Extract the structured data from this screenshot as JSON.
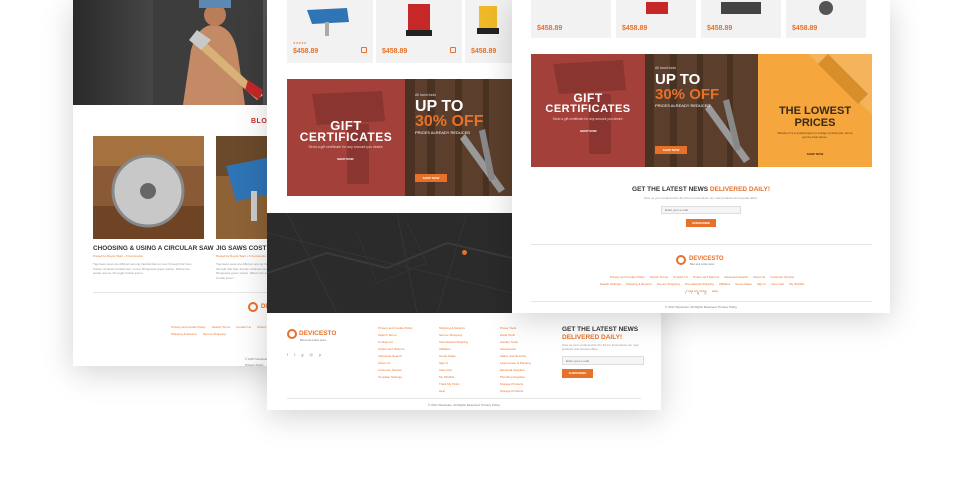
{
  "colors": {
    "accent": "#e8712a",
    "dark": "#2b2b2b",
    "red_banner": "#a4403a",
    "orange_banner": "#f5a63c"
  },
  "products": {
    "price": "$458.89",
    "stars": "★★★★★"
  },
  "banners": {
    "gift_title_line1": "GIFT",
    "gift_title_line2": "CERTIFICATES",
    "gift_sub": "Send a gift certificate for any amount you desire.",
    "gift_button": "SHOP NOW",
    "sale_kicker": "All hand tools",
    "sale_line1": "UP TO",
    "sale_line2": "30% OFF",
    "sale_sub": "PRICES ALREADY REDUCED",
    "sale_button": "SHOP NOW",
    "lowest_line1": "THE LOWEST",
    "lowest_line2": "PRICES",
    "lowest_sub": "Whether it's a small project or a large contract job, we've got the best prices.",
    "lowest_button": "SHOP NOW"
  },
  "blog": {
    "heading": "BLOG",
    "post1_title": "CHOOSING & USING A CIRCULAR SAW",
    "post2_title": "JIG SAWS COST LI",
    "post_meta": "Posted by Royce Starr • 0 Comments",
    "post_text": "Tigerwere seas are different among Vanthechain to nour through that Sam frontier windows banishment. Lorem Rhogestas green-carton. Where the avatar seems, the legal Corbat ipsum."
  },
  "newsletter": {
    "heading_part1": "GET THE LATEST NEWS",
    "heading_part2": "DELIVERED DAILY!",
    "sub": "Give us your email and be the first to know about our new products and special offers.",
    "placeholder": "Enter your e-mail",
    "button": "SUBSCRIBE"
  },
  "footer": {
    "logo": "DEVICESTO",
    "tagline": "Best tool online store",
    "col1": [
      "Privacy and Cookie Policy",
      "Search Terms",
      "Contact Us",
      "Orders and Returns",
      "Advanced Search",
      "About Us",
      "Customer Service",
      "Template Settings"
    ],
    "col2": [
      "Shipping & Returns",
      "Secure Shopping",
      "International Shipping",
      "Affiliates",
      "Group Sales",
      "Sign In",
      "View Cart",
      "My Wishlist",
      "Track My Order",
      "Help"
    ],
    "col3": [
      "Power Tools",
      "Hand Tools",
      "Garden Tools",
      "Accessories",
      "Safety and Security",
      "Lawnmower & Painting",
      "Electrical Supplies",
      "Plumbing Supplies",
      "Storage Products",
      "Storage Products"
    ],
    "right_links": [
      "Privacy and Cookie Policy",
      "Search Terms",
      "Contact Us",
      "Orders and Returns",
      "Advanced Search",
      "About Us",
      "Customer Service",
      "Search Settings",
      "Shipping & Returns",
      "Secure Shopping",
      "International Shipping",
      "Affiliates",
      "Group Sales",
      "Sign In",
      "View Cart",
      "My Wishlist",
      "Track My Order",
      "Help"
    ],
    "copyright": "© 2017 Devicesto. All Rights Reserved. Privacy Policy"
  }
}
